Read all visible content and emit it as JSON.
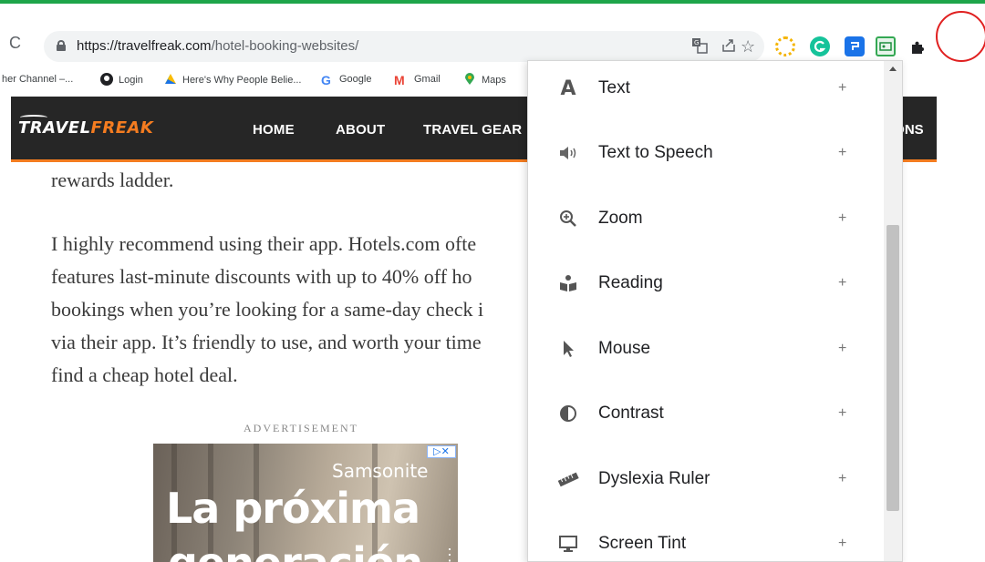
{
  "browser": {
    "url_host": "https://travelfreak.com",
    "url_path": "/hotel-booking-websites/",
    "omnibox_icons": [
      "translate-icon",
      "share-icon",
      "bookmark-star-icon"
    ],
    "extensions": [
      {
        "name": "color-wheel-extension-icon",
        "color": "#f4b400"
      },
      {
        "name": "grammarly-extension-icon",
        "color": "#15c39a"
      },
      {
        "name": "blue-square-extension-icon",
        "color": "#1a73e8"
      },
      {
        "name": "accessibility-extension-icon",
        "color": "#34a853"
      },
      {
        "name": "puzzle-extensions-icon",
        "color": "#202124"
      }
    ]
  },
  "bookmarks": [
    {
      "label": "her Channel –...",
      "icon": "none"
    },
    {
      "label": "Login",
      "icon": "github-icon"
    },
    {
      "label": "Here's Why People Belie...",
      "icon": "google-drive-icon"
    },
    {
      "label": "Google",
      "icon": "google-icon"
    },
    {
      "label": "Gmail",
      "icon": "gmail-icon"
    },
    {
      "label": "Maps",
      "icon": "maps-pin-icon"
    }
  ],
  "site": {
    "logo_part1": "TRAVEL",
    "logo_part2": "FREAK",
    "nav": [
      "HOME",
      "ABOUT",
      "TRAVEL GEAR"
    ],
    "nav_tail": "IONS",
    "accent_color": "#f47c20"
  },
  "article": {
    "p1": "rewards ladder.",
    "p2_lines": [
      "I highly recommend using their app. Hotels.com ofte",
      "features last-minute discounts with up to 40% off ho",
      "bookings when you’re looking for a same-day check i",
      "via their app. It’s friendly to use, and worth your time",
      "find a cheap hotel deal."
    ],
    "ad_label": "ADVERTISEMENT"
  },
  "ad": {
    "brand": "Samsonite",
    "headline1": "La próxima",
    "headline2": "generación",
    "choices_label": "▷✕",
    "more": "⋮"
  },
  "panel": {
    "items": [
      {
        "label": "Text",
        "icon": "text-icon",
        "action": "+"
      },
      {
        "label": "Text to Speech",
        "icon": "speaker-icon",
        "action": "+"
      },
      {
        "label": "Zoom",
        "icon": "zoom-icon",
        "action": "+"
      },
      {
        "label": "Reading",
        "icon": "reading-icon",
        "action": "+"
      },
      {
        "label": "Mouse",
        "icon": "mouse-pointer-icon",
        "action": "+"
      },
      {
        "label": "Contrast",
        "icon": "contrast-icon",
        "action": "+"
      },
      {
        "label": "Dyslexia Ruler",
        "icon": "ruler-icon",
        "action": "+"
      },
      {
        "label": "Screen Tint",
        "icon": "monitor-icon",
        "action": "+"
      }
    ]
  }
}
